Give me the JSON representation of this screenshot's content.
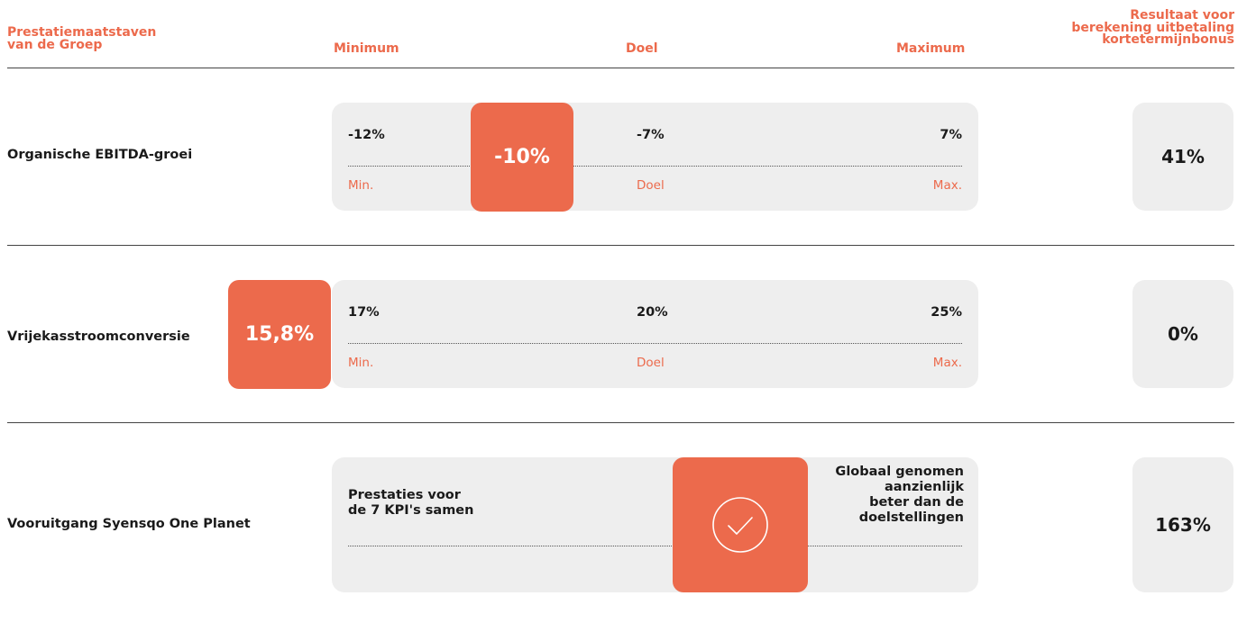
{
  "header": {
    "metric_line1": "Prestatiemaatstaven",
    "metric_line2": "van de Groep",
    "minimum": "Minimum",
    "target": "Doel",
    "maximum": "Maximum",
    "result_line1": "Resultaat voor",
    "result_line2": "berekening uitbetaling",
    "result_line3": "kortetermijnbonus"
  },
  "rows": [
    {
      "label": "Organische EBITDA-groei",
      "min_value": "-12%",
      "target_value": "-7%",
      "max_value": "7%",
      "min_tick": "Min.",
      "target_tick": "Doel",
      "max_tick": "Max.",
      "actual": "-10%",
      "result": "41%"
    },
    {
      "label": "Vrijekasstroomconversie",
      "min_value": "17%",
      "target_value": "20%",
      "max_value": "25%",
      "min_tick": "Min.",
      "target_tick": "Doel",
      "max_tick": "Max.",
      "actual": "15,8%",
      "result": "0%"
    },
    {
      "label": "Vooruitgang Syensqo One Planet",
      "left_line1": "Prestaties voor",
      "left_line2": "de 7 KPI's samen",
      "right_line1": "Globaal genomen",
      "right_line2": "aanzienlijk",
      "right_line3": "beter dan de",
      "right_line4": "doelstellingen",
      "marker_icon": "check-circle-icon",
      "result": "163%"
    }
  ],
  "colors": {
    "accent": "#ec6a4c",
    "panel": "#eeeeee",
    "text": "#1a1a1a"
  }
}
